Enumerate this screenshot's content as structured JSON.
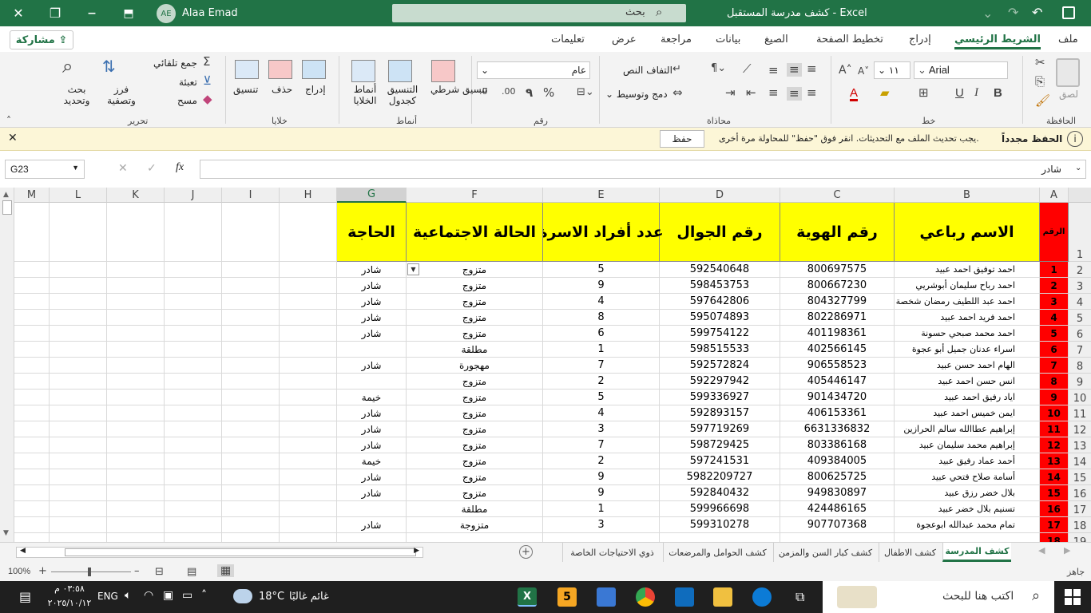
{
  "titlebar": {
    "filename": "كشف مدرسة المستقبل",
    "app": "Excel",
    "user": "Alaa Emad",
    "initials": "AE",
    "search": "بحث"
  },
  "menu": {
    "items": [
      "ملف",
      "الشريط الرئيسي",
      "إدراج",
      "تخطيط الصفحة",
      "الصيغ",
      "بيانات",
      "مراجعة",
      "عرض",
      "تعليمات"
    ],
    "share": "مشاركة"
  },
  "ribbon": {
    "clipboard": {
      "paste": "لصق",
      "name": "الحافظة"
    },
    "font": {
      "family": "Arial",
      "size": "١١",
      "name": "خط"
    },
    "align": {
      "wrap": "التفاف النص",
      "merge": "دمج وتوسيط",
      "name": "محاذاة"
    },
    "number": {
      "format": "عام",
      "name": "رقم"
    },
    "styles": {
      "cond": "تنسيق شرطي",
      "table": "التنسيق كجدول",
      "cellstyles": "أنماط الخلايا",
      "name": "أنماط"
    },
    "cells": {
      "insert": "إدراج",
      "delete": "حذف",
      "format": "تنسيق",
      "name": "خلايا"
    },
    "edit": {
      "autosum": "جمع تلقائي",
      "fill": "تعبئة",
      "clear": "مسح",
      "sort": "فرز وتصفية",
      "find": "بحث وتحديد",
      "name": "تحرير"
    }
  },
  "msgbar": {
    "title": "الحفظ مجدداً",
    "text": "يجب تحديث الملف مع التحديثات. انقر فوق \"حفظ\" للمحاولة مرة أخرى.",
    "button": "حفظ"
  },
  "formula": {
    "namebox": "G23",
    "fx": "fx",
    "content": "شادر"
  },
  "columns": [
    "A",
    "B",
    "C",
    "D",
    "E",
    "F",
    "G",
    "H",
    "I",
    "J",
    "K",
    "L",
    "M"
  ],
  "headers": {
    "num": "الرقم",
    "name": "الاسم رباعي",
    "id": "رقم الهوية",
    "mobile": "رقم الجوال",
    "family": "عدد أفراد الاسرة",
    "status": "الحالة الاجتماعية",
    "need": "الحاجة"
  },
  "rownums": [
    "1",
    "2",
    "3",
    "4",
    "5",
    "6",
    "7",
    "8",
    "9",
    "10",
    "11",
    "12",
    "13",
    "14",
    "15",
    "16",
    "17",
    "18",
    "19"
  ],
  "rows": [
    [
      "1",
      "احمد توفيق احمد عبيد",
      "800697575",
      "592540648",
      "5",
      "متزوج",
      "شادر"
    ],
    [
      "2",
      "احمد رباح سليمان أبوشريي",
      "800667230",
      "598453753",
      "9",
      "متزوج",
      "شادر"
    ],
    [
      "3",
      "احمد عبد اللطيف رمضان شخصة",
      "804327799",
      "597642806",
      "4",
      "متزوج",
      "شادر"
    ],
    [
      "4",
      "احمد فريد احمد عبيد",
      "802286971",
      "595074893",
      "8",
      "متزوج",
      "شادر"
    ],
    [
      "5",
      "احمد محمد صبحي حسونة",
      "401198361",
      "599754122",
      "6",
      "متزوج",
      "شادر"
    ],
    [
      "6",
      "اسراء عدنان جميل أبو عجوة",
      "402566145",
      "598515533",
      "1",
      "مطلقة",
      ""
    ],
    [
      "7",
      "الهام احمد حسن عبيد",
      "906558523",
      "592572824",
      "7",
      "مهجورة",
      "شادر"
    ],
    [
      "8",
      "انس حسن احمد عبيد",
      "405446147",
      "592297942",
      "2",
      "متزوج",
      ""
    ],
    [
      "9",
      "اياد رفيق احمد عبيد",
      "901434720",
      "599336927",
      "5",
      "متزوج",
      "خيمة"
    ],
    [
      "10",
      "ايمن خميس احمد عبيد",
      "406153361",
      "592893157",
      "4",
      "متزوج",
      "شادر"
    ],
    [
      "11",
      "إبراهيم عطاالله سالم الحرازين",
      "6631336832",
      "597719269",
      "3",
      "متزوج",
      "شادر"
    ],
    [
      "12",
      "إبراهيم محمد سليمان عبيد",
      "803386168",
      "598729425",
      "7",
      "متزوج",
      "شادر"
    ],
    [
      "13",
      "أحمد عماد رفيق عبيد",
      "409384005",
      "597241531",
      "2",
      "متزوج",
      "خيمة"
    ],
    [
      "14",
      "أسامة صلاح فتحي عبيد",
      "800625725",
      "5982209727",
      "9",
      "متزوج",
      "شادر"
    ],
    [
      "15",
      "بلال خضر رزق عبيد",
      "949830897",
      "592840432",
      "9",
      "متزوج",
      "شادر"
    ],
    [
      "16",
      "تسنيم بلال خضر عبيد",
      "424486165",
      "599966698",
      "1",
      "مطلقة",
      ""
    ],
    [
      "17",
      "تمام محمد عبدالله ابوعجوة",
      "907707368",
      "599310278",
      "3",
      "متزوجة",
      "شادر"
    ],
    [
      "18",
      "",
      "",
      "",
      "",
      "",
      ""
    ]
  ],
  "sheets": [
    "كشف المدرسة",
    "كشف الاطفال",
    "كشف كبار السن والمزمن",
    "كشف الحوامل والمرضعات",
    "ذوي الاحتياجات الخاصة"
  ],
  "status": {
    "zoom": "100%",
    "ready": "جاهز"
  },
  "taskbar": {
    "search": "اكتب هنا للبحث",
    "weather": "غائم غالبًا",
    "temp": "18°C",
    "lang": "ENG",
    "time": "٠٣:٥٨ م",
    "date": "٢٠٢٥/١٠/١٢"
  },
  "colors": {
    "excel_green": "#217346",
    "header_yellow": "#ffff00",
    "number_red": "#ff0000"
  }
}
